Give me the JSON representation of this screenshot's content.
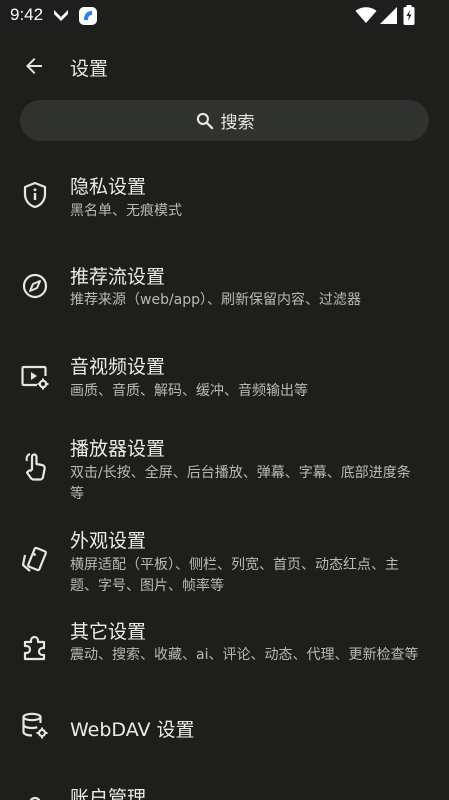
{
  "status_bar": {
    "time": "9:42",
    "icons": [
      "download-arrow-icon",
      "app-notification-icon",
      "wifi-icon",
      "signal-icon",
      "battery-charging-icon"
    ]
  },
  "app_bar": {
    "back_icon": "arrow-back-icon",
    "title": "设置"
  },
  "search": {
    "icon": "search-icon",
    "label": "搜索"
  },
  "settings": [
    {
      "icon": "shield-info-icon",
      "title": "隐私设置",
      "subtitle": "黑名单、无痕模式"
    },
    {
      "icon": "compass-icon",
      "title": "推荐流设置",
      "subtitle": "推荐来源（web/app）、刷新保留内容、过滤器"
    },
    {
      "icon": "video-settings-icon",
      "title": "音视频设置",
      "subtitle": "画质、音质、解码、缓冲、音频输出等"
    },
    {
      "icon": "touch-gesture-icon",
      "title": "播放器设置",
      "subtitle": "双击/长按、全屏、后台播放、弹幕、字幕、底部进度条等"
    },
    {
      "icon": "cards-appearance-icon",
      "title": "外观设置",
      "subtitle": "横屏适配（平板）、侧栏、列宽、首页、动态红点、主题、字号、图片、帧率等"
    },
    {
      "icon": "puzzle-extension-icon",
      "title": "其它设置",
      "subtitle": "震动、搜索、收藏、ai、评论、动态、代理、更新检查等"
    },
    {
      "icon": "database-settings-icon",
      "title": "WebDAV 设置",
      "subtitle": ""
    },
    {
      "icon": "account-icon",
      "title": "账户管理",
      "subtitle": ""
    }
  ]
}
